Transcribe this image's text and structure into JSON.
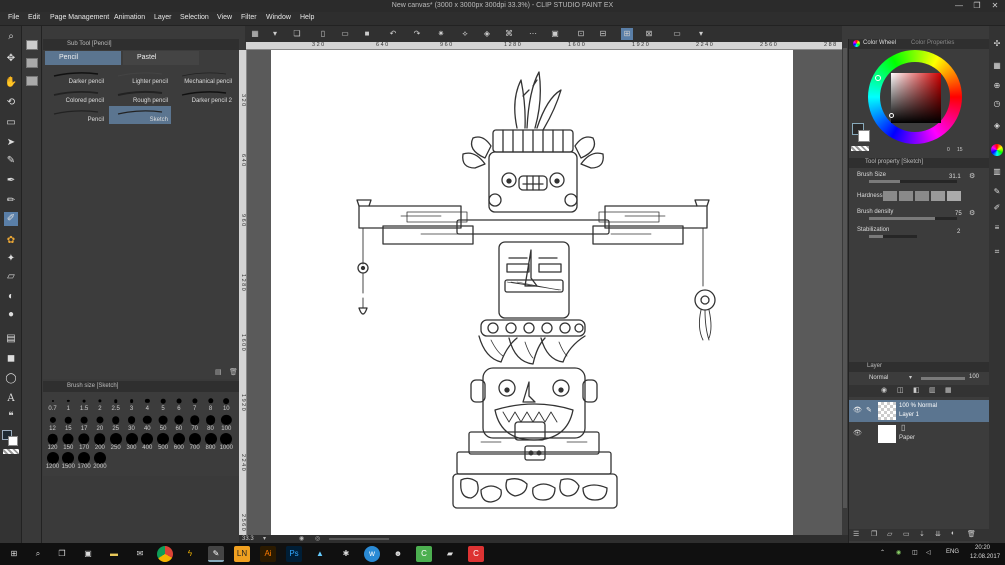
{
  "window": {
    "title": "New canvas* (3000 x 3000px 300dpi 33.3%) - CLIP STUDIO PAINT EX",
    "minimize": "—",
    "maximize": "❐",
    "close": "✕"
  },
  "menu": [
    "File",
    "Edit",
    "Page Management",
    "Animation",
    "Layer",
    "Selection",
    "View",
    "Filter",
    "Window",
    "Help"
  ],
  "subtool": {
    "header": "Sub Tool [Pencil]",
    "tabs": [
      "Pencil",
      "Pastel"
    ],
    "brushes": [
      "Darker pencil",
      "Lighter pencil",
      "Mechanical pencil",
      "Colored pencil",
      "Rough pencil",
      "Darker pencil 2",
      "Pencil",
      "Sketch"
    ],
    "selected_brush": "Sketch"
  },
  "brush_size": {
    "header": "Brush size [Sketch]",
    "sizes": [
      "0.7",
      "1",
      "1.5",
      "2",
      "2.5",
      "3",
      "4",
      "5",
      "6",
      "7",
      "8",
      "10",
      "12",
      "15",
      "17",
      "20",
      "25",
      "30",
      "40",
      "50",
      "60",
      "70",
      "80",
      "100",
      "120",
      "150",
      "170",
      "200",
      "250",
      "300",
      "400",
      "500",
      "600",
      "700",
      "800",
      "1000",
      "1200",
      "1500",
      "1700",
      "2000"
    ]
  },
  "ruler": {
    "top": [
      "3 2 0",
      "6 4 0",
      "9 6 0",
      "1 2 8 0",
      "1 6 0 0",
      "1 9 2 0",
      "2 2 4 0",
      "2 5 6 0",
      "2 8 8"
    ],
    "left": [
      "3 2 0",
      "6 4 0",
      "9 6 0",
      "1 2 8 0",
      "1 6 0 0",
      "1 9 2 0",
      "2 2 4 0",
      "2 5 6 0"
    ]
  },
  "status": {
    "zoom": "33.3"
  },
  "color_wheel": {
    "tab1": "Color Wheel",
    "tab2": "Color Properties",
    "value_label": "0",
    "value_label2": "15",
    "main_color": "#2a2a2a",
    "sub_color": "#ffffff"
  },
  "tool_property": {
    "header": "Tool property [Sketch]",
    "brush_size_label": "Brush Size",
    "brush_size_value": "31.1",
    "hardness_label": "Hardness",
    "brush_density_label": "Brush density",
    "brush_density_value": "75",
    "stabilization_label": "Stabilization",
    "stabilization_value": "2",
    "brush_size_fill": 0.35,
    "density_fill": 0.75,
    "stabilization_fill": 0.3
  },
  "layer": {
    "header": "Layer",
    "blend_mode": "Normal",
    "opacity": "100",
    "layers": [
      {
        "mode": "100 % Normal",
        "name": "Layer 1"
      },
      {
        "mode": "",
        "name": "Paper"
      }
    ]
  },
  "taskbar": {
    "apps": [
      "LN",
      "Ai",
      "Ps"
    ],
    "lang": "ENG",
    "time": "20:20",
    "date": "12.08.2017"
  },
  "colors": {
    "accent": "#5a7fa8",
    "selected_row": "#5b7590",
    "ai": "#ff7c00",
    "ps": "#31a8ff"
  }
}
